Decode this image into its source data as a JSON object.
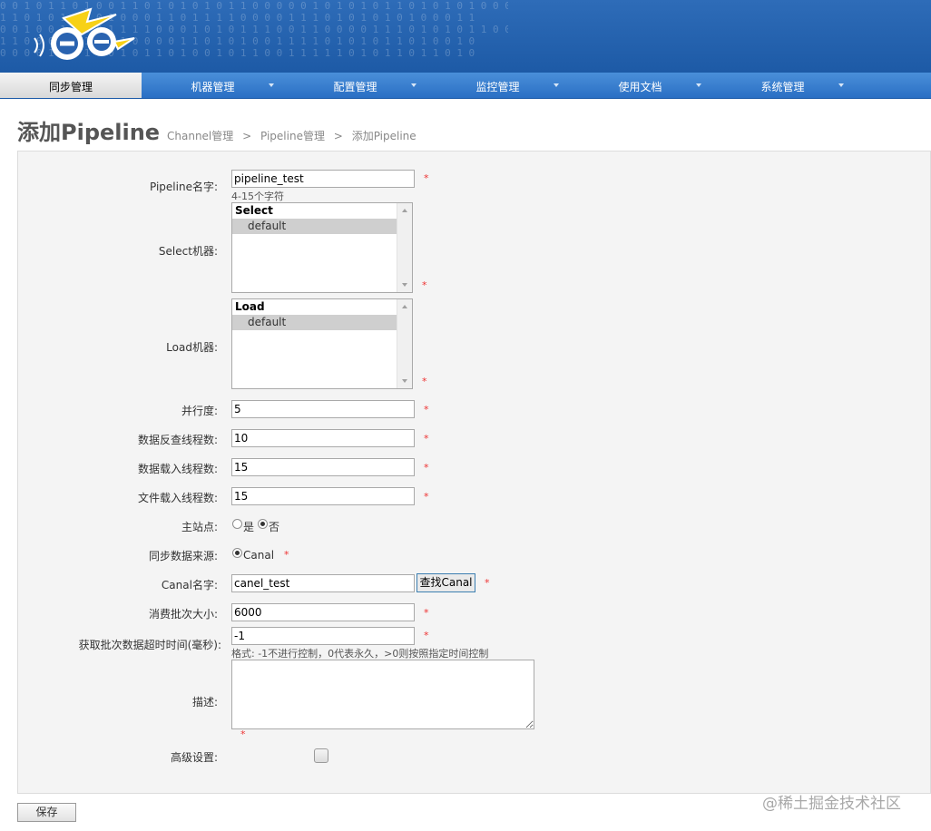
{
  "nav": {
    "items": [
      {
        "label": "同步管理",
        "active": true,
        "has_dropdown": false
      },
      {
        "label": "机器管理",
        "active": false,
        "has_dropdown": true
      },
      {
        "label": "配置管理",
        "active": false,
        "has_dropdown": true
      },
      {
        "label": "监控管理",
        "active": false,
        "has_dropdown": true
      },
      {
        "label": "使用文档",
        "active": false,
        "has_dropdown": true
      },
      {
        "label": "系统管理",
        "active": false,
        "has_dropdown": true
      }
    ]
  },
  "header": {
    "title": "添加Pipeline",
    "breadcrumb": [
      "Channel管理",
      ">",
      "Pipeline管理",
      ">",
      "添加Pipeline"
    ]
  },
  "form": {
    "pipeline_name": {
      "label": "Pipeline名字:",
      "value": "pipeline_test",
      "hint": "4-15个字符"
    },
    "select_machine": {
      "label": "Select机器:",
      "group": "Select",
      "option": "default"
    },
    "load_machine": {
      "label": "Load机器:",
      "group": "Load",
      "option": "default"
    },
    "parallelism": {
      "label": "并行度:",
      "value": "5"
    },
    "extract_threads": {
      "label": "数据反查线程数:",
      "value": "10"
    },
    "load_threads": {
      "label": "数据载入线程数:",
      "value": "15"
    },
    "file_load_threads": {
      "label": "文件载入线程数:",
      "value": "15"
    },
    "home_site": {
      "label": "主站点:",
      "options": [
        "是",
        "否"
      ],
      "selected": "否"
    },
    "data_source": {
      "label": "同步数据来源:",
      "option": "Canal"
    },
    "canal_name": {
      "label": "Canal名字:",
      "value": "canel_test",
      "button": "查找Canal"
    },
    "batch_size": {
      "label": "消费批次大小:",
      "value": "6000"
    },
    "batch_timeout": {
      "label": "获取批次数据超时时间(毫秒):",
      "value": "-1",
      "hint": "格式: -1不进行控制，0代表永久，>0则按照指定时间控制"
    },
    "description": {
      "label": "描述:",
      "value": ""
    },
    "advanced": {
      "label": "高级设置:"
    },
    "required_mark": "*"
  },
  "actions": {
    "save_label": "保存"
  },
  "watermark": "@稀土掘金技术社区",
  "colors": {
    "banner": "#1d5aa6",
    "nav": "#2a6fc4",
    "required": "#e33333"
  }
}
